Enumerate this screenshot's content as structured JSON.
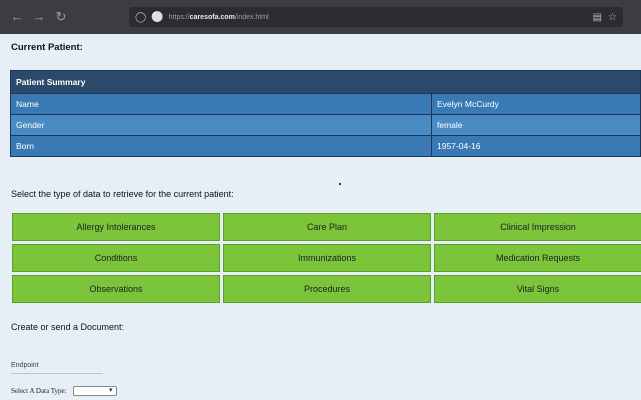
{
  "browser": {
    "url_prefix": "https://",
    "url_domain": "caresofa.com",
    "url_path": "/index.html",
    "icons": [
      "back-icon",
      "forward-icon",
      "reload-icon",
      "shield-icon",
      "lock-icon",
      "reader-icon",
      "bookmark-star-icon"
    ]
  },
  "page": {
    "title": "Current Patient:",
    "select_prompt": "Select the type of data to retrieve for the current patient:",
    "document_prompt": "Create or send a Document:"
  },
  "summary": {
    "header": "Patient Summary",
    "rows": [
      {
        "label": "Name",
        "value": "Evelyn McCurdy"
      },
      {
        "label": "Gender",
        "value": "female"
      },
      {
        "label": "Born",
        "value": "1957-04-16"
      }
    ]
  },
  "buttons": [
    "Allergy Intolerances",
    "Care Plan",
    "Clinical Impression",
    "Conditions",
    "Immunizations",
    "Medication Requests",
    "Observations",
    "Procedures",
    "Vital Signs"
  ],
  "document": {
    "endpoint_placeholder": "Endpoint",
    "datatype_label": "Select A Data Type:",
    "datatype_selected": ""
  },
  "colors": {
    "summary_header": "#2b4a6b",
    "summary_row": "#3a7ab4",
    "button_green": "#7cc43a",
    "page_bg": "#e6eef6"
  }
}
